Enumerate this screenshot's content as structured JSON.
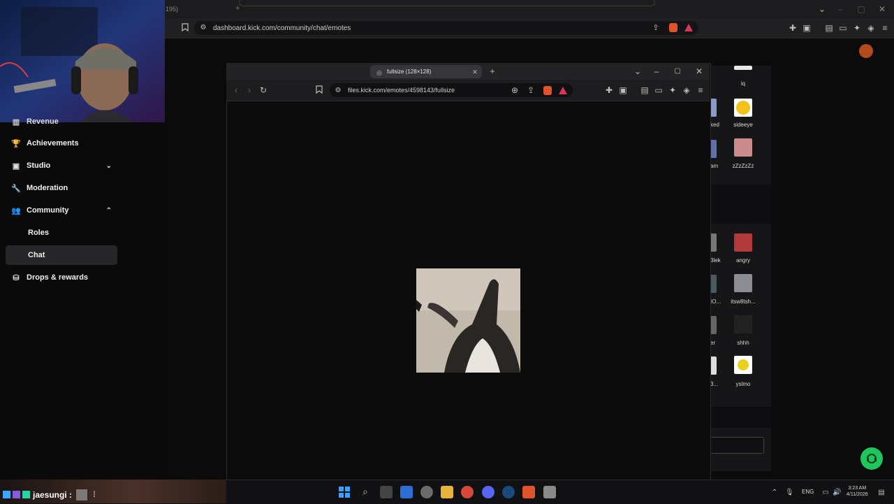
{
  "back_browser": {
    "tab_partial": "195)",
    "url": "dashboard.kick.com/community/chat/emotes"
  },
  "sidebar": {
    "items": [
      {
        "label": "Revenue",
        "icon": "revenue-icon"
      },
      {
        "label": "Achievements",
        "icon": "trophy-icon"
      },
      {
        "label": "Studio",
        "icon": "studio-icon"
      },
      {
        "label": "Moderation",
        "icon": "wrench-icon"
      },
      {
        "label": "Community",
        "icon": "people-icon"
      },
      {
        "label": "Roles"
      },
      {
        "label": "Chat"
      },
      {
        "label": "Drops & rewards",
        "icon": "drops-icon"
      }
    ],
    "active": "Chat"
  },
  "popup": {
    "tab_title": "fullsize (128×128)",
    "url": "files.kick.com/emotes/4598143/fullsize"
  },
  "emotes": [
    {
      "label": "iq"
    },
    {
      "label": "sideeye",
      "left_label": "ked"
    },
    {
      "label": "zZzZzZz",
      "left_label": "am"
    },
    {
      "label": "angry",
      "left_label": "3lek"
    },
    {
      "label": "itsw8tsh...",
      "left_label": "IO..."
    },
    {
      "label": "shhh",
      "left_label": "er"
    },
    {
      "label": "yslmo",
      "left_label": "3..."
    }
  ],
  "overlay": {
    "username": "jaesungi :"
  },
  "tray": {
    "language": "ENG",
    "time": "3:23 AM",
    "date": "4/11/2026"
  },
  "colors": {
    "accent_green": "#21c55d",
    "active_item_bg": "#262629"
  }
}
